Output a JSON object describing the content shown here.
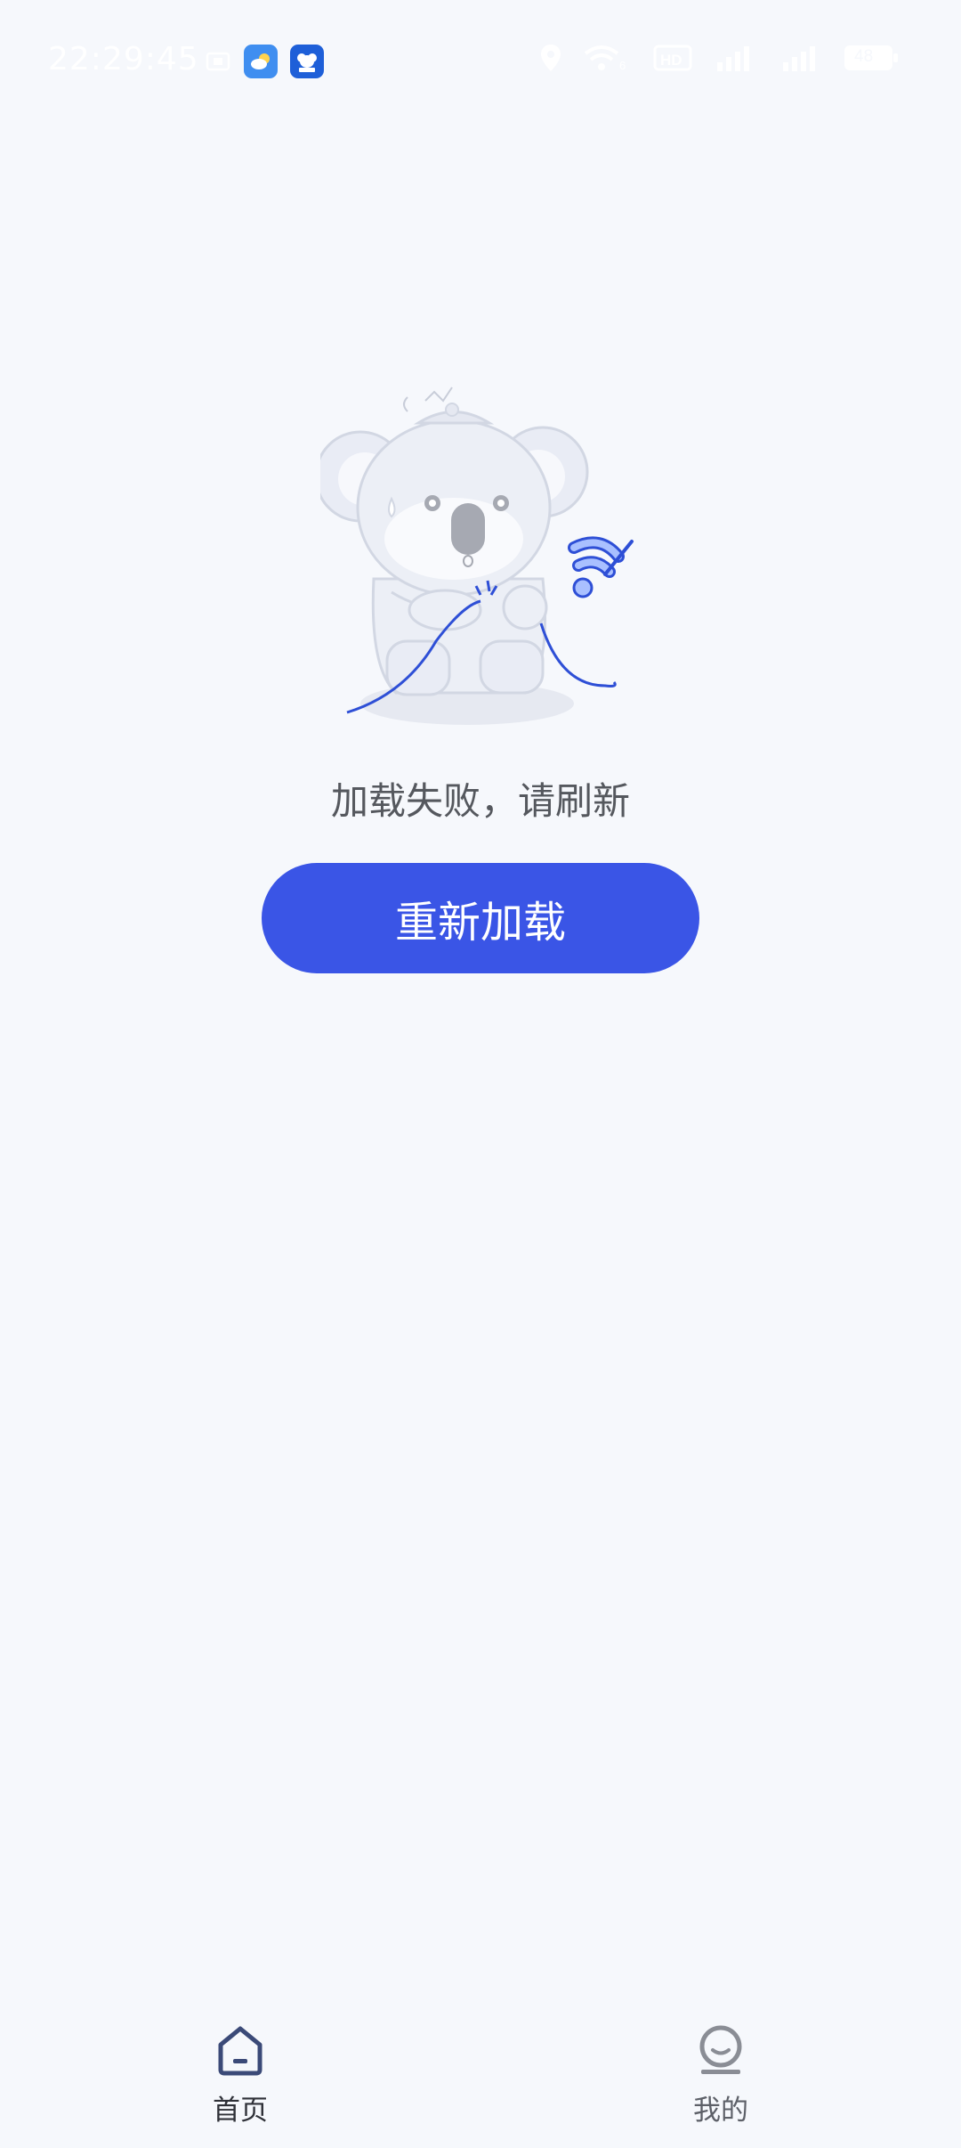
{
  "status_bar": {
    "time": "22:29:45",
    "hd_label": "HD",
    "battery": "48"
  },
  "main": {
    "error_message": "加载失败，请刷新",
    "reload_button_label": "重新加载"
  },
  "bottom_nav": {
    "items": [
      {
        "label": "首页",
        "icon": "home-icon",
        "active": true
      },
      {
        "label": "我的",
        "icon": "profile-icon",
        "active": false
      }
    ]
  },
  "colors": {
    "background": "#f6f8fc",
    "accent": "#3a55e6",
    "nav_active": "#3b4a78",
    "nav_inactive": "#8a8d95"
  }
}
